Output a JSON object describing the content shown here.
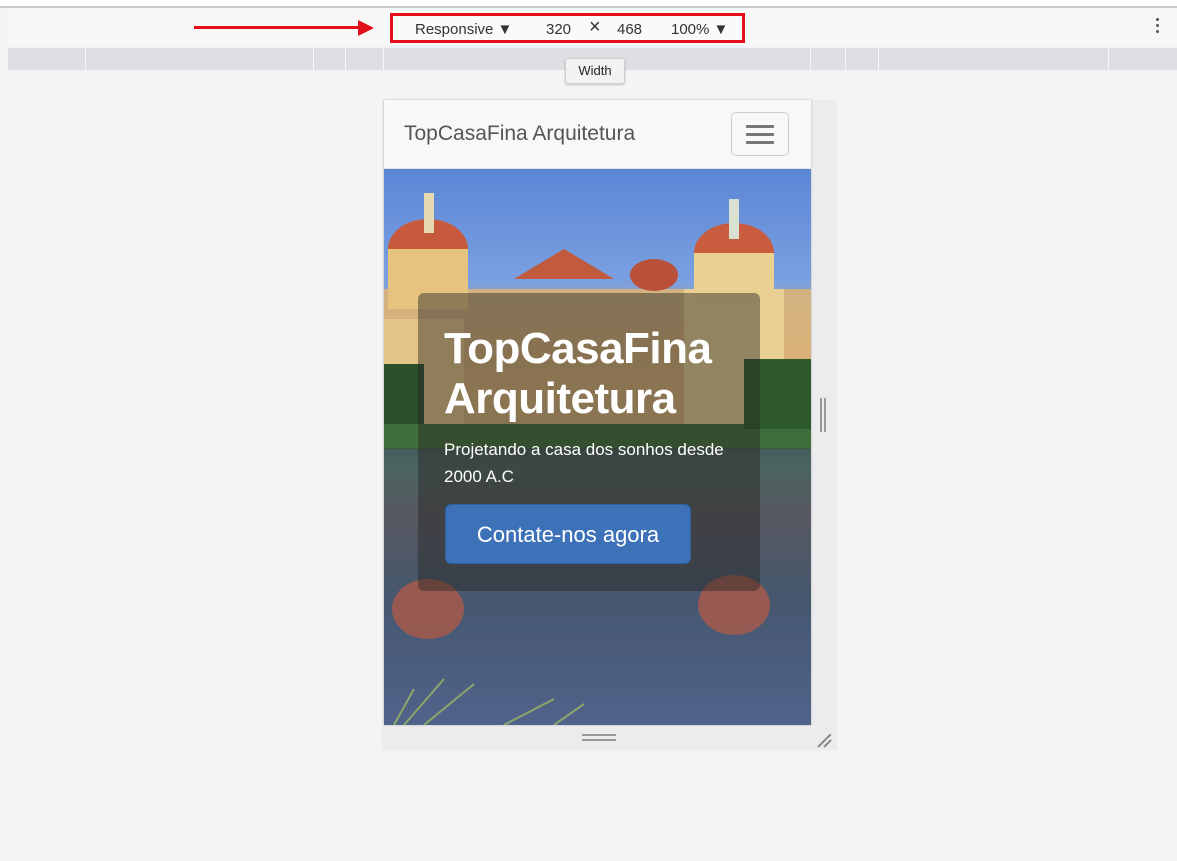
{
  "devtools": {
    "device_label": "Responsive ▼",
    "width_value": "320",
    "times_symbol": "×",
    "height_value": "468",
    "zoom_label": "100% ▼",
    "more_icon": "kebab-menu-icon",
    "tooltip": "Width",
    "highlight_color": "#e2101a"
  },
  "site": {
    "brand": "TopCasaFina Arquitetura",
    "menu_icon": "hamburger-icon",
    "hero_title": "TopCasaFina Arquitetura",
    "hero_subtitle": "Projetando a casa dos sonhos desde 2000 A.C",
    "cta_label": "Contate-nos agora",
    "cta_color": "#3d72b8"
  }
}
